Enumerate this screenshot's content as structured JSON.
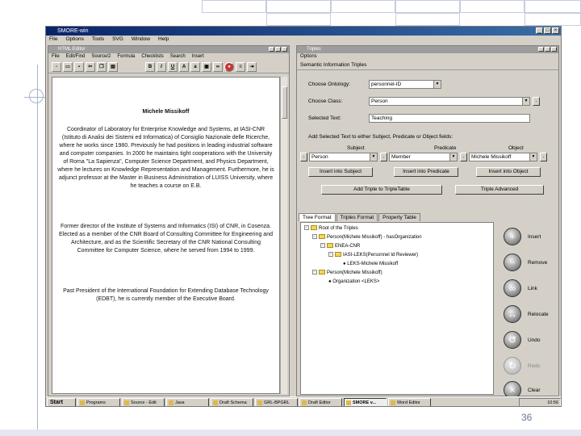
{
  "slide": {
    "page_number": "36"
  },
  "app": {
    "title": "SMORE-win",
    "menu": [
      "File",
      "Options",
      "Tools",
      "SVG",
      "Window",
      "Help"
    ]
  },
  "editor": {
    "title": "HTML Editor",
    "menu": [
      "File",
      "Edit/Find",
      "Source/2",
      "Formula",
      "Checklists",
      "Search",
      "Insert"
    ],
    "toolbar": [
      "new-icon",
      "open-icon",
      "save-icon",
      "cut-icon",
      "copy-icon",
      "paste-icon",
      "bold-icon",
      "italic-icon",
      "underline-icon",
      "font-larger-icon",
      "font-smaller-icon",
      "image-icon",
      "link-icon",
      "stop-icon",
      "list-icon",
      "indent-icon"
    ],
    "doc_name": "Michele Missikoff",
    "paragraphs": [
      "Coordinator of Laboratory for Enterprise Knowledge and Systems, at IASI-CNR (Istituto di Analisi dei Sistemi ed Informatica) of Consiglio Nazionale delle Ricerche, where he works since 1980. Previously he had positions in leading industrial software and computer companies. In 2000 he maintains tight cooperations with the University of Roma \"La Sapienza\", Computer Science Department, and Physics Department, where he lectures on Knowledge Representation and Management. Furthermore, he is adjunct professor at the Master in Business Administration of LUISS University, where he teaches a course on E.B.",
      "Former director of the Institute of Systems and Informatics (ISI) of CNR, in Cosenza. Elected as a member of the CNR Board of Consulting Committee for Engineering and Architecture, and as the Scientific Secretary of the CNR National Consulting Committee for Computer Science, where he served from 1994 to 1999.",
      "Past President of the International Foundation for Extending Database Technology (EDBT), he is currently member of the Executive Board."
    ]
  },
  "triples": {
    "title": "Triples",
    "menu": "Options",
    "section_title": "Semantic Information Triples",
    "choose_ontology_label": "Choose Ontology:",
    "choose_ontology_value": "personnel-ID",
    "choose_class_label": "Choose Class:",
    "choose_class_value": "Person",
    "selected_text_label": "Selected Text:",
    "selected_text_value": "Teaching",
    "add_selected_label": "Add Selected Text to either Subject, Predicate or Object fields:",
    "subject_label": "Subject",
    "predicate_label": "Predicate",
    "object_label": "Object",
    "subject_value": "Person",
    "predicate_value": "Member",
    "object_value": "Michele Missikoff",
    "insert_subject": "Insert into Subject",
    "insert_predicate": "Insert into Predicate",
    "insert_object": "Insert into Object",
    "add_triple": "Add Triple to TripleTable",
    "triple_advanced": "Triple Advanced",
    "tabs": [
      "Tree Format",
      "Triples Format",
      "Property Table"
    ],
    "tree": [
      "Root of the Triples",
      "Person(Michele Missikoff) - hasOrganization",
      "ENEA-CNR",
      "IASI-LEKS(Personnel Id Reviewer)",
      "LEKS-Michele Missikoff",
      "Person(Michele Missikoff)",
      "Organization <LEKS>"
    ],
    "side_buttons": [
      {
        "label": "Insert",
        "icon": "plus-icon"
      },
      {
        "label": "Remove",
        "icon": "minus-icon"
      },
      {
        "label": "Link",
        "icon": "link-icon"
      },
      {
        "label": "Relocate",
        "icon": "relocate-icon"
      },
      {
        "label": "Undo",
        "icon": "undo-icon"
      },
      {
        "label": "Redo",
        "icon": "redo-icon"
      },
      {
        "label": "Clear",
        "icon": "clear-icon"
      }
    ]
  },
  "taskbar": {
    "start": "Start",
    "tasks": [
      "Programs",
      "Source - Edit",
      "Java",
      "Draft Schema",
      "GRL-BPGRL",
      "Draft Editor",
      "SMORE v...",
      "Word Editor"
    ],
    "active_index": 6,
    "clock": "10:56"
  }
}
